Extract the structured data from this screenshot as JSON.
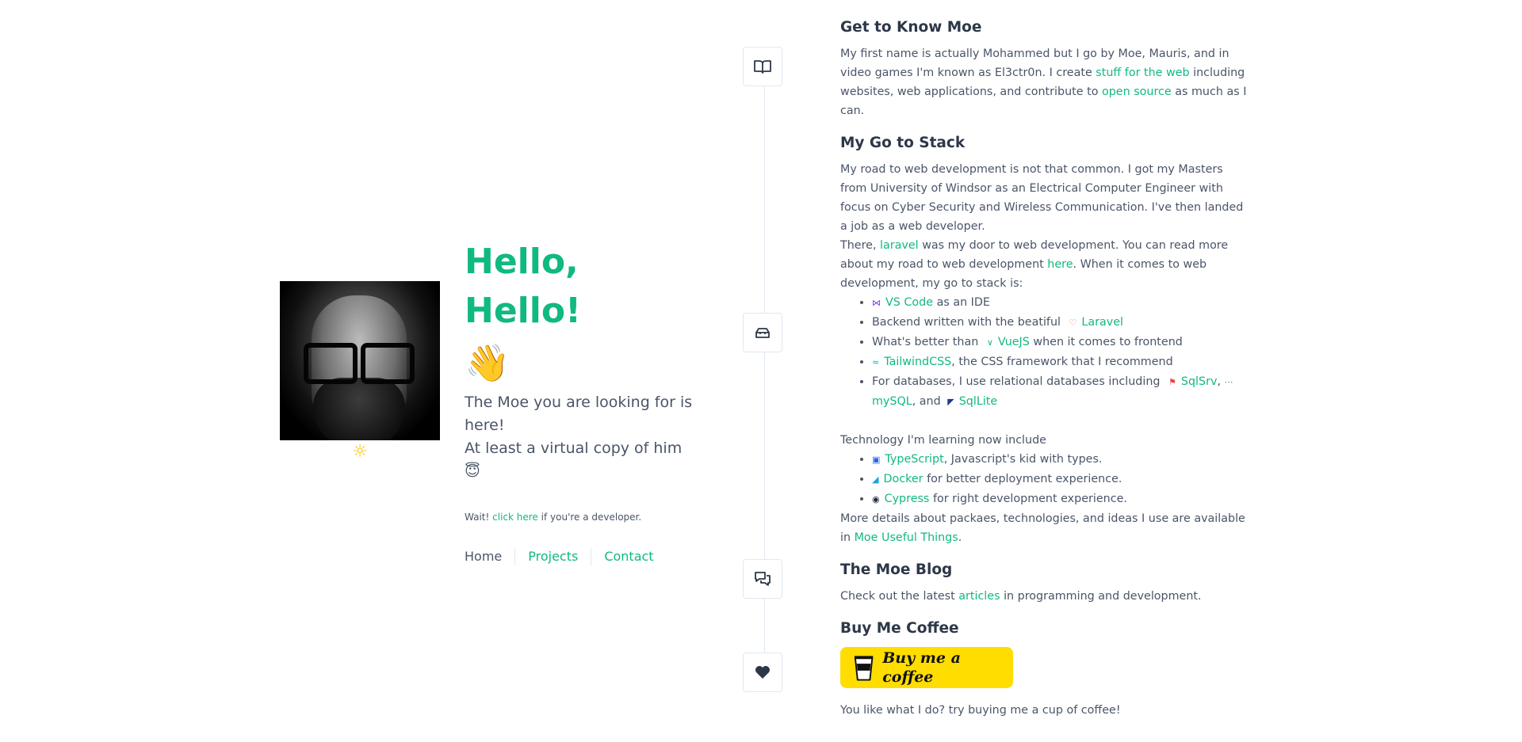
{
  "intro": {
    "greeting": "Hello, Hello!",
    "wave_emoji": "👋",
    "tagline_line1": "The Moe you are looking for is here!",
    "tagline_line2": "At least a virtual copy of him",
    "tagline_emoji": "😇",
    "note_prefix": "Wait!",
    "note_link": "click here",
    "note_suffix": "if you're a developer."
  },
  "theme_toggle_icon": "sun-icon",
  "nav": {
    "home": "Home",
    "projects": "Projects",
    "contact": "Contact"
  },
  "timeline_icons": [
    "book-icon",
    "toolbox-icon",
    "chat-icon",
    "heart-icon"
  ],
  "sections": {
    "about": {
      "title": "Get to Know Moe",
      "t1": "My first name is actually Mohammed but I go by Moe, Mauris, and in video games I'm known as El3ctr0n. I create",
      "l1": "stuff for the web",
      "t2": "including websites, web applications, and contribute to",
      "l2": "open source",
      "t3": "as much as I can."
    },
    "stack": {
      "title": "My Go to Stack",
      "p1": "My road to web development is not that common. I got my Masters from University of Windsor as an Electrical Computer Engineer with focus on Cyber Security and Wireless Communication. I've then landed a job as a web developer.",
      "p2_a": "There,",
      "p2_l1": "laravel",
      "p2_b": "was my door to web development. You can read more about my road to web development",
      "p2_l2": "here",
      "p2_c": ". When it comes to web development, my go to stack is:",
      "item1_link": "VS Code",
      "item1_text": "as an IDE",
      "item2_text": "Backend written with the beatiful",
      "item2_link": "Laravel",
      "item3_text": "What's better than",
      "item3_link": "VueJS",
      "item3_text2": "when it comes to frontend",
      "item4_link": "TailwindCSS",
      "item4_text": ", the CSS framework that I recommend",
      "item5_text": "For databases, I use relational databases including",
      "item5_l1": "SqlSrv",
      "item5_sep": ",",
      "item5_l2": "mySQL",
      "item5_and": ", and",
      "item5_l3": "SqlLite",
      "learning_intro": "Technology I'm learning now include",
      "learn1_link": "TypeScript",
      "learn1_text": ", Javascript's kid with types.",
      "learn2_link": "Docker",
      "learn2_text": "for better deployment experience.",
      "learn3_link": "Cypress",
      "learn3_text": "for right development experience.",
      "more_text": "More details about packaes, technologies, and ideas I use are available in",
      "more_link": "Moe Useful Things",
      "more_end": "."
    },
    "blog": {
      "title": "The Moe Blog",
      "t1": "Check out the latest",
      "link": "articles",
      "t2": "in programming and development."
    },
    "coffee": {
      "title": "Buy Me Coffee",
      "button_label": "Buy me a coffee",
      "text": "You like what I do? try buying me a cup of coffee!"
    }
  },
  "colors": {
    "accent": "#10b981",
    "text": "#4a5568",
    "heading": "#2d3748",
    "coffee": "#ffdd00"
  }
}
